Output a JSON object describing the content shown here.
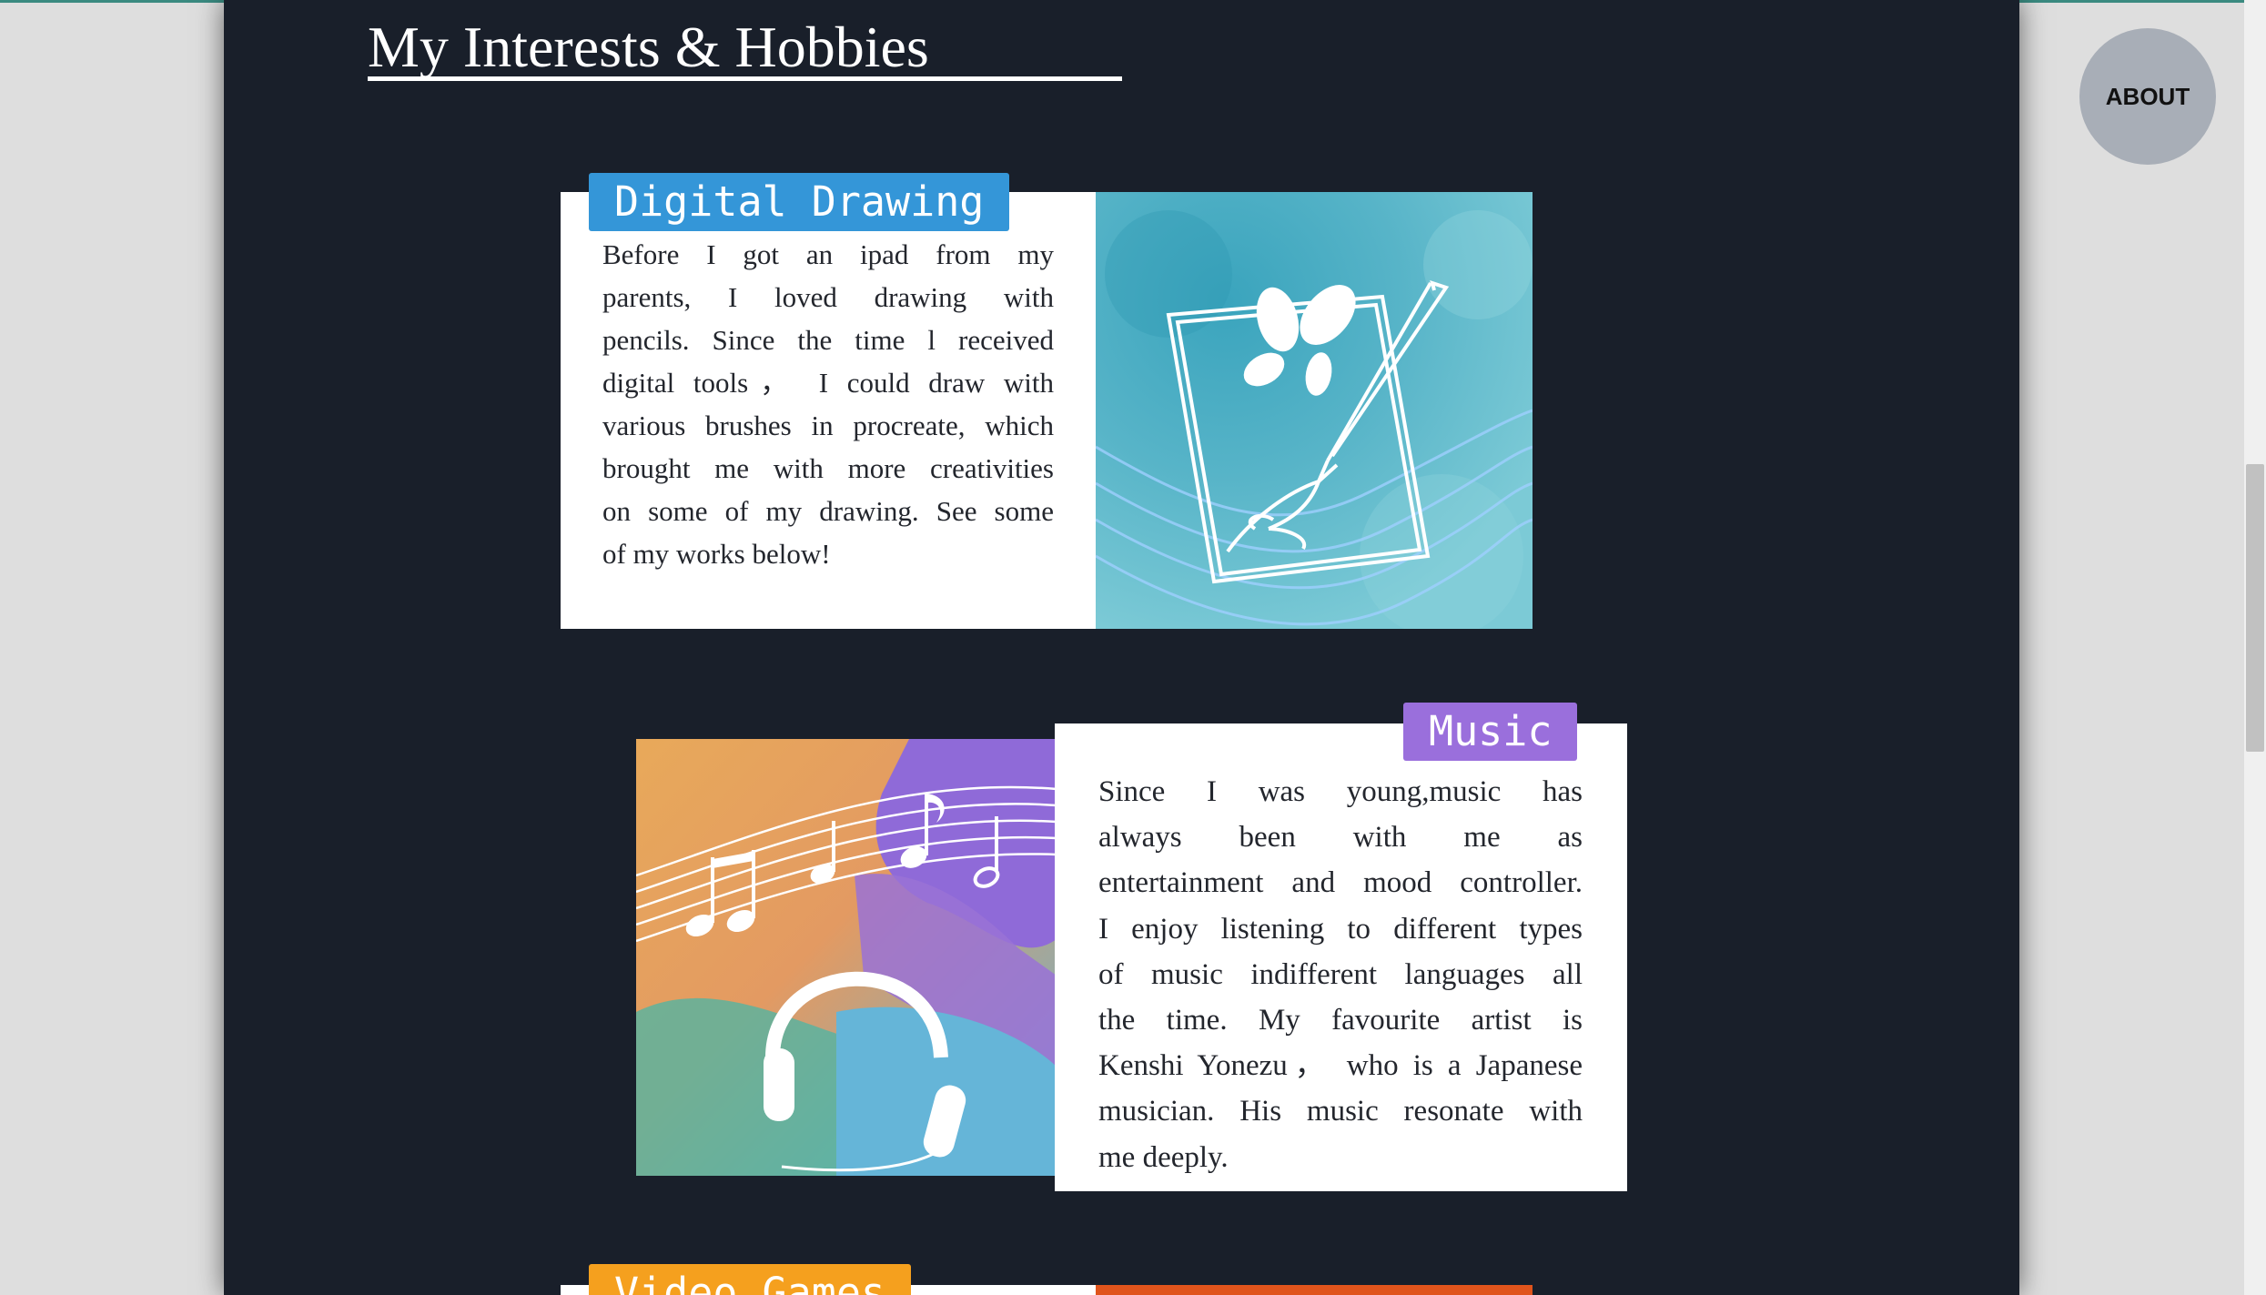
{
  "page": {
    "title": "My Interests & Hobbies"
  },
  "nav": {
    "about_label": "ABOUT"
  },
  "hobbies": [
    {
      "tag": "Digital Drawing",
      "tag_color": "#3496d8",
      "image_icon": "tablet-drawing-illustration",
      "lines": [
        "Before I got an ipad from my",
        "parents, I loved drawing with",
        "pencils. Since the time l received",
        "digital tools， I could draw with",
        "various brushes in procreate, which",
        "brought me with more creativities",
        "on some of my drawing. See some",
        "of my works below!"
      ]
    },
    {
      "tag": "Music",
      "tag_color": "#9a6fdc",
      "image_icon": "headphones-music-notes-illustration",
      "lines": [
        "Since I was young,music has",
        "always been with me as",
        "entertainment and mood controller.",
        "I enjoy listening to different types",
        "of music indifferent languages all",
        "the time. My favourite artist is",
        "Kenshi Yonezu， who is a Japanese",
        "musician. His music resonate with",
        "me deeply."
      ]
    },
    {
      "tag": "Video Games",
      "tag_color": "#f5a01e",
      "image_icon": "video-games-illustration"
    }
  ]
}
